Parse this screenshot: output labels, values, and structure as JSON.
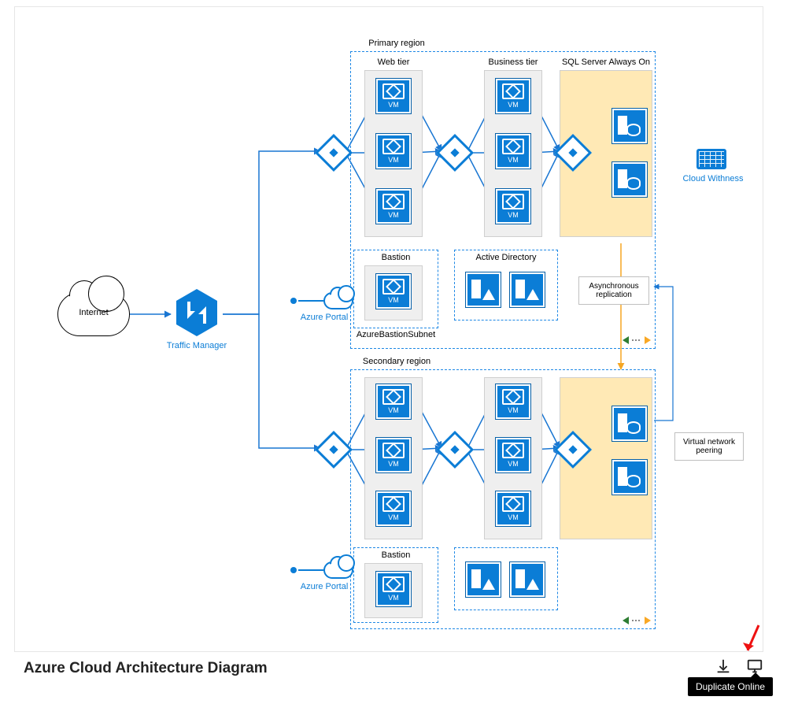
{
  "title": "Azure Cloud Architecture Diagram",
  "tooltip": "Duplicate Online",
  "internet": {
    "label": "Internet"
  },
  "traffic_manager": {
    "label": "Traffic Manager"
  },
  "azure_portal": {
    "label": "Azure Portal"
  },
  "cloud_witness": {
    "label": "Cloud Withness"
  },
  "primary": {
    "title": "Primary region",
    "web_tier": "Web tier",
    "business_tier": "Business tier",
    "sql": "SQL Server Always On",
    "bastion": "Bastion",
    "active_directory": "Active Directory",
    "bastion_subnet": "AzureBastionSubnet",
    "vm_caption": "VM"
  },
  "secondary": {
    "title": "Secondary region",
    "bastion": "Bastion",
    "vm_caption": "VM"
  },
  "notes": {
    "async": "Asynchronous replication",
    "vnet_peering": "Virtual network peering"
  }
}
